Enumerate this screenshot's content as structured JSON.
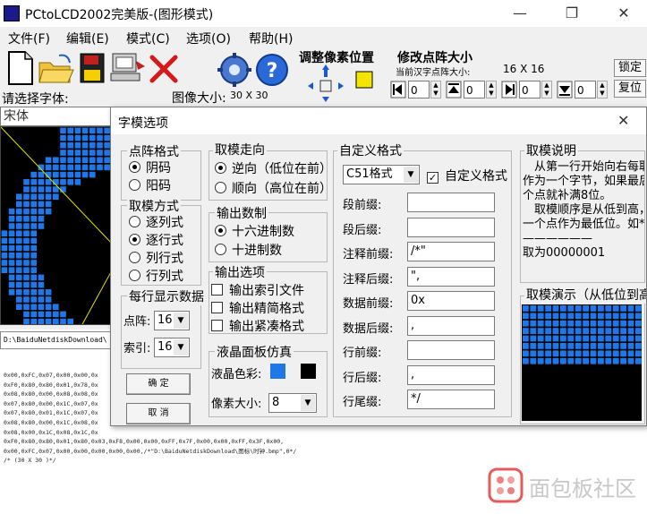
{
  "window": {
    "title": "PCtoLCD2002完美版-(图形模式)",
    "minimize_glyph": "—",
    "maximize_glyph": "❐",
    "close_glyph": "✕"
  },
  "menu": [
    "文件(F)",
    "编辑(E)",
    "模式(C)",
    "选项(O)",
    "帮助(H)"
  ],
  "toolbar": {
    "adjust_pixel_label": "调整像素位置",
    "modify_matrix_label": "修改点阵大小",
    "current_size_label": "当前汉字点阵大小:",
    "current_size_value": "16 X 16",
    "confirm_label": "锁定",
    "reset_label": "复位",
    "spin_values": [
      "0",
      "0",
      "0",
      "0"
    ]
  },
  "left": {
    "choose_font_label": "请选择字体:",
    "font_value": "宋体",
    "image_size_label": "图像大小:",
    "image_size_value": "30 X 30",
    "path_text": "D:\\BaiduNetdiskDownload\\",
    "output_lines": [
      "0x00,0xFC,0x07,0x00,0x00,0x",
      "0xF0,0x80,0x80,0x01,0x78,0x",
      "0x08,0x80,0x00,0x08,0x08,0x",
      "0x07,0x80,0x00,0x1C,0x07,0x",
      "0x07,0x80,0x01,0x1C,0x07,0x",
      "0x08,0x80,0x00,0x1C,0x08,0x",
      "0x08,0x00,0x1C,0x08,0x1C,0x",
      "0xF0,0x80,0x80,0x01,0x80,0x03,0xF8,0x00,0x00,0xFF,0x7F,0x00,0x00,0xFF,0x3F,0x00,",
      "0x00,0xFC,0x07,0x00,0x00,0x00,0x00,0x00,/*\"D:\\BaiduNetdiskDownload\\图标\\时钟.bmp\",0*/",
      "/* (30 X 30 )*/"
    ]
  },
  "dialog": {
    "title": "字模选项",
    "close_glyph": "✕",
    "dot_format": {
      "title": "点阵格式",
      "options": [
        "阴码",
        "阳码"
      ],
      "selected": 0
    },
    "scan_mode": {
      "title": "取模方式",
      "options": [
        "逐列式",
        "逐行式",
        "列行式",
        "行列式"
      ],
      "selected": 1
    },
    "per_line": {
      "title": "每行显示数据",
      "dots_label": "点阵:",
      "dots_value": "16",
      "index_label": "索引:",
      "index_value": "16"
    },
    "ok_label": "确   定",
    "cancel_label": "取   消",
    "direction": {
      "title": "取模走向",
      "options": [
        "逆向（低位在前）",
        "顺向（高位在前）"
      ],
      "selected": 0
    },
    "base": {
      "title": "输出数制",
      "options": [
        "十六进制数",
        "十进制数"
      ],
      "selected": 0
    },
    "output_opts": {
      "title": "输出选项",
      "options": [
        "输出索引文件",
        "输出精简格式",
        "输出紧凑格式"
      ]
    },
    "lcd": {
      "title": "液晶面板仿真",
      "color_label": "液晶色彩:",
      "pixel_label": "像素大小:",
      "pixel_value": "8",
      "fg_color": "#1e78e8",
      "bg_color": "#000000"
    },
    "custom": {
      "title": "自定义格式",
      "format_value": "C51格式",
      "custom_check_label": "自定义格式",
      "fields": [
        {
          "label": "段前缀:",
          "value": ""
        },
        {
          "label": "段后缀:",
          "value": ""
        },
        {
          "label": "注释前缀:",
          "value": "/*\""
        },
        {
          "label": "注释后缀:",
          "value": "\","
        },
        {
          "label": "数据前缀:",
          "value": "0x"
        },
        {
          "label": "数据后缀:",
          "value": ","
        },
        {
          "label": "行前缀:",
          "value": ""
        },
        {
          "label": "行后缀:",
          "value": ","
        },
        {
          "label": "行尾缀:",
          "value": "*/"
        }
      ]
    },
    "explain": {
      "title": "取模说明",
      "text": "　从第一行开始向右每取8个点作为一个字节，如果最后不足8个点就补满8位。\n　取模顺序是从低到高，即第一个点作为最低位。如*——————\n取为00000001"
    },
    "demo_title": "取模演示（从低位到高位）"
  },
  "watermark": "面包板社区",
  "colors": {
    "pixel_blue": "#1e78e8"
  }
}
